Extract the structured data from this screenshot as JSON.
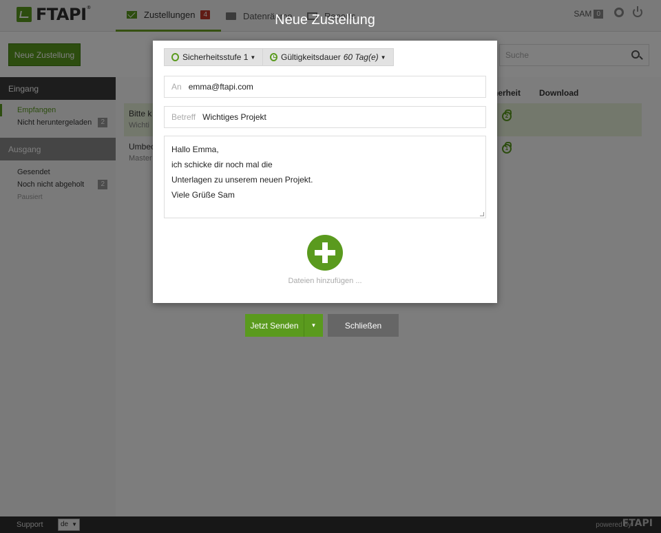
{
  "header": {
    "logo_text": "FTAPI",
    "logo_reg": "®",
    "tabs": [
      {
        "label": "Zustellungen",
        "badge": "4"
      },
      {
        "label": "Datenräume"
      },
      {
        "label": "Reports"
      }
    ],
    "user": "SAM",
    "user_badge": "0"
  },
  "sidebar": {
    "new_button": "Neue Zustellung",
    "inbox_title": "Eingang",
    "inbox_items": [
      {
        "label": "Empfangen"
      },
      {
        "label": "Nicht heruntergeladen",
        "count": "2"
      }
    ],
    "outbox_title": "Ausgang",
    "outbox_items": [
      {
        "label": "Gesendet"
      },
      {
        "label": "Noch nicht abgeholt",
        "count": "2"
      },
      {
        "label": "Pausiert"
      }
    ]
  },
  "main": {
    "search_placeholder": "Suche",
    "col_security": "herheit",
    "col_download": "Download",
    "rows": [
      {
        "title": "Bitte k",
        "sub": "Wichti",
        "level": "2"
      },
      {
        "title": "Umbec",
        "sub": "Master",
        "level": "1"
      }
    ]
  },
  "modal": {
    "title": "Neue Zustellung",
    "security_chip": "Sicherheitsstufe 1",
    "validity_label": "Gültigkeitsdauer",
    "validity_value": "60 Tag(e)",
    "to_label": "An",
    "to_value": "emma@ftapi.com",
    "subject_label": "Betreff",
    "subject_value": "Wichtiges Projekt",
    "message_lines": [
      "Hallo Emma,",
      "ich schicke dir noch mal die",
      "Unterlagen zu unserem neuen Projekt.",
      "Viele Grüße Sam"
    ],
    "add_files_label": "Dateien hinzufügen ...",
    "send_button": "Jetzt Senden",
    "close_button": "Schließen"
  },
  "footer": {
    "support": "Support",
    "language": "de",
    "powered_by": "powered by",
    "powered_logo": "FTAPI"
  },
  "colors": {
    "brand_green": "#5a9a1e",
    "badge_red": "#c0392b"
  }
}
